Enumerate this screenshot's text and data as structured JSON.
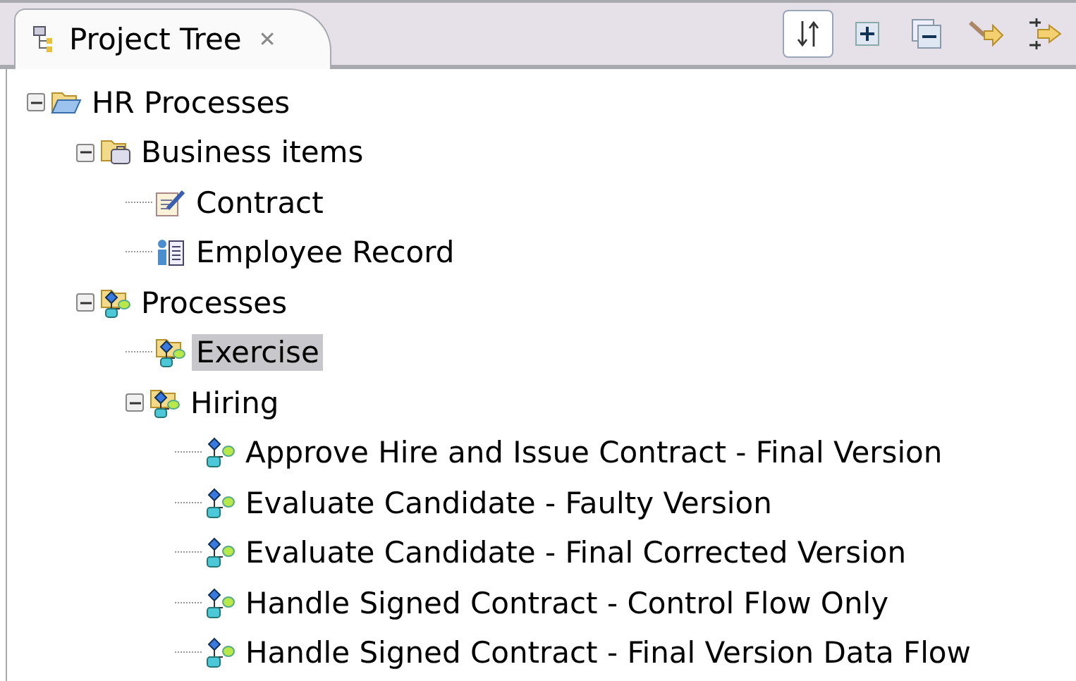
{
  "view_tab": {
    "title": "Project Tree",
    "close": "✕"
  },
  "toolbar": [
    {
      "kind": "sort",
      "pressed": true
    },
    {
      "kind": "expand",
      "pressed": false
    },
    {
      "kind": "collapse",
      "pressed": false
    },
    {
      "kind": "link",
      "pressed": false
    },
    {
      "kind": "sync",
      "pressed": false
    }
  ],
  "tree": [
    {
      "label": "HR Processes",
      "kind": "folder",
      "expanded": true,
      "selected": false,
      "children": [
        {
          "label": "Business items",
          "kind": "business",
          "expanded": true,
          "selected": false,
          "children": [
            {
              "label": "Contract",
              "kind": "document",
              "selected": false
            },
            {
              "label": "Employee Record",
              "kind": "record",
              "selected": false
            }
          ]
        },
        {
          "label": "Processes",
          "kind": "processes",
          "expanded": true,
          "selected": false,
          "children": [
            {
              "label": "Exercise",
              "kind": "processes",
              "selected": true
            },
            {
              "label": "Hiring",
              "kind": "processes",
              "expanded": true,
              "selected": false,
              "children": [
                {
                  "label": "Approve Hire and Issue Contract - Final Version",
                  "kind": "process",
                  "selected": false
                },
                {
                  "label": "Evaluate Candidate - Faulty Version",
                  "kind": "process",
                  "selected": false
                },
                {
                  "label": "Evaluate Candidate - Final Corrected Version",
                  "kind": "process",
                  "selected": false
                },
                {
                  "label": "Handle Signed Contract - Control Flow Only",
                  "kind": "process",
                  "selected": false
                },
                {
                  "label": "Handle Signed Contract - Final Version Data Flow",
                  "kind": "process",
                  "selected": false
                }
              ]
            }
          ]
        }
      ]
    }
  ]
}
